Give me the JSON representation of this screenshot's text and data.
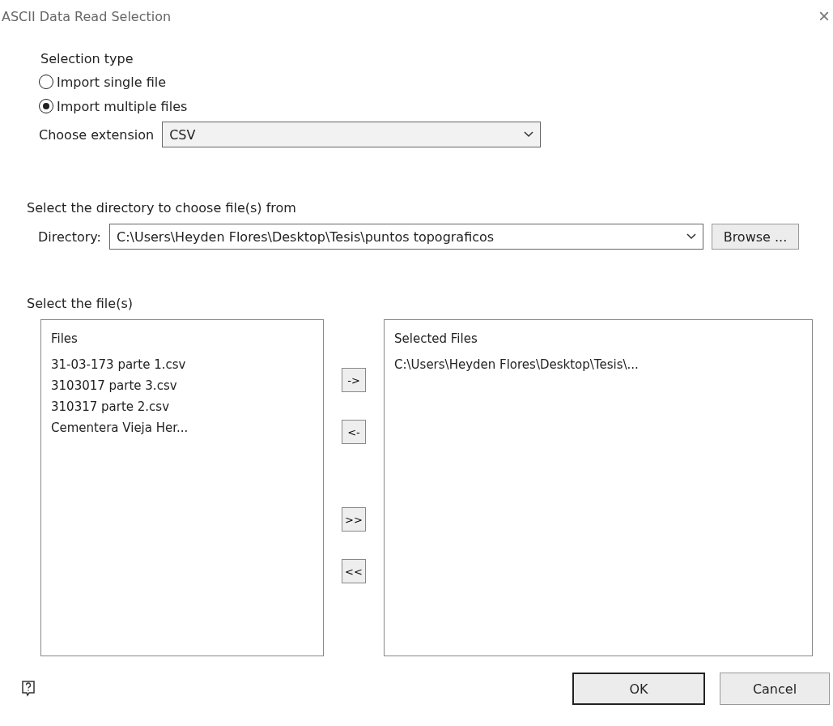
{
  "window": {
    "title": "ASCII Data Read Selection",
    "close": "×"
  },
  "selection_type": {
    "heading": "Selection type",
    "options": [
      {
        "label": "Import single file",
        "selected": false
      },
      {
        "label": "Import multiple files",
        "selected": true
      }
    ],
    "extension_label": "Choose extension",
    "extension_value": "CSV"
  },
  "directory": {
    "heading": "Select the directory to choose file(s) from",
    "label": "Directory:",
    "value": "C:\\Users\\Heyden Flores\\Desktop\\Tesis\\puntos topograficos",
    "browse": "Browse ..."
  },
  "files": {
    "heading": "Select the file(s)",
    "available": {
      "title": "Files",
      "items": [
        "31-03-173 parte 1.csv",
        "3103017 parte 3.csv",
        "310317 parte 2.csv",
        "Cementera Vieja Her..."
      ]
    },
    "move_buttons": [
      "->",
      "<-",
      ">>",
      "<<"
    ],
    "selected": {
      "title": "Selected Files",
      "items": [
        "C:\\Users\\Heyden Flores\\Desktop\\Tesis\\..."
      ]
    }
  },
  "buttons": [
    {
      "label": "OK",
      "default": true
    },
    {
      "label": "Cancel",
      "default": false
    }
  ]
}
